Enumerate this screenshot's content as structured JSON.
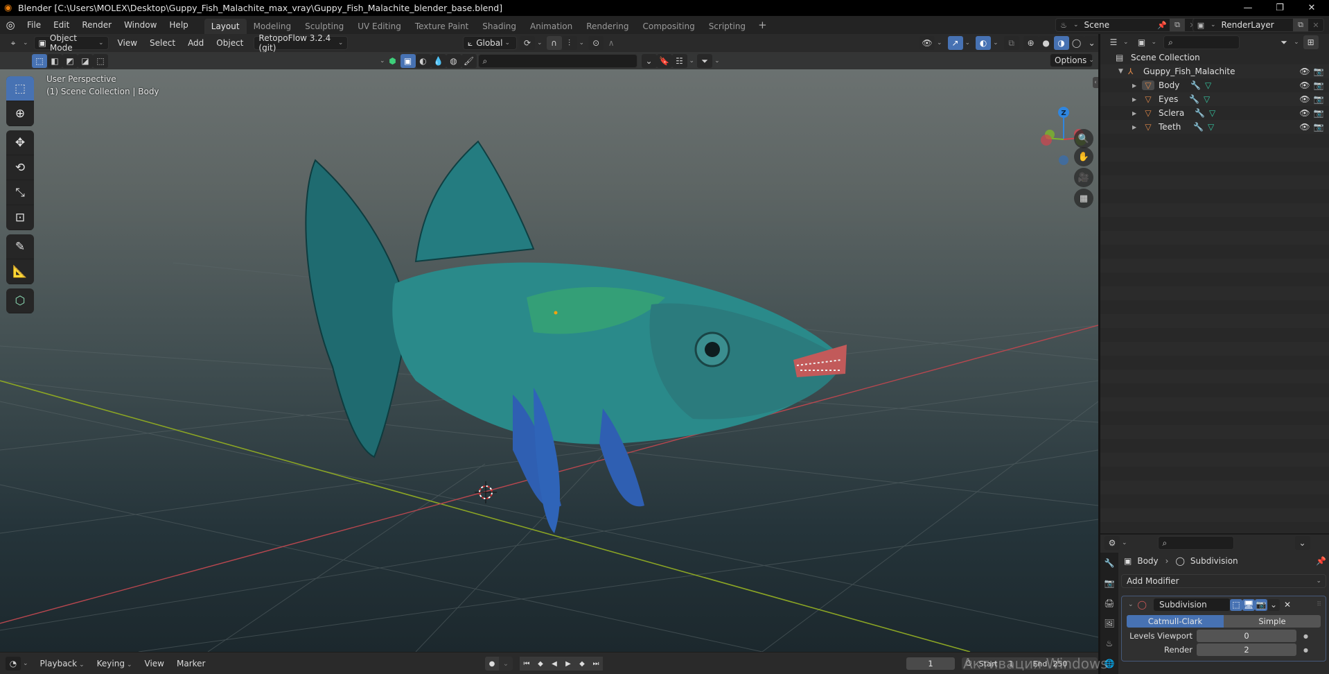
{
  "window": {
    "title": "Blender [C:\\Users\\MOLEX\\Desktop\\Guppy_Fish_Malachite_max_vray\\Guppy_Fish_Malachite_blender_base.blend]",
    "controls": [
      "minimize",
      "restore",
      "close"
    ]
  },
  "menubar": {
    "items": [
      "File",
      "Edit",
      "Render",
      "Window",
      "Help"
    ],
    "workspaces": [
      "Layout",
      "Modeling",
      "Sculpting",
      "UV Editing",
      "Texture Paint",
      "Shading",
      "Animation",
      "Rendering",
      "Compositing",
      "Scripting"
    ],
    "active_workspace": "Layout",
    "add_workspace": "+",
    "scene": "Scene",
    "view_layer": "RenderLayer"
  },
  "viewport": {
    "mode": "Object Mode",
    "menus": [
      "View",
      "Select",
      "Add",
      "Object"
    ],
    "addon_menu": "RetopoFlow 3.2.4 (git)",
    "transform_orientation": "Global",
    "options_label": "Options",
    "overlay_title": "User Perspective",
    "overlay_subtitle": "(1) Scene Collection | Body",
    "gizmo_axes": {
      "z": "Z"
    },
    "accent_color": "#4772b3"
  },
  "toolbar": {
    "tools": [
      "select-box",
      "cursor",
      "move",
      "rotate",
      "scale",
      "transform",
      "annotate",
      "measure",
      "add-cube"
    ],
    "active": "select-box"
  },
  "outliner": {
    "root": "Scene Collection",
    "collection": "Guppy_Fish_Malachite",
    "objects": [
      {
        "name": "Body",
        "active": true
      },
      {
        "name": "Eyes",
        "active": false
      },
      {
        "name": "Sclera",
        "active": false
      },
      {
        "name": "Teeth",
        "active": false
      }
    ]
  },
  "properties": {
    "breadcrumb_object": "Body",
    "breadcrumb_modifier": "Subdivision",
    "add_modifier_label": "Add Modifier",
    "modifier": {
      "name": "Subdivision",
      "types": [
        "Catmull-Clark",
        "Simple"
      ],
      "active_type": "Catmull-Clark",
      "levels_viewport_label": "Levels Viewport",
      "levels_viewport": "0",
      "render_label": "Render",
      "render": "2"
    }
  },
  "timeline": {
    "menus": [
      "Playback",
      "Keying",
      "View",
      "Marker"
    ],
    "current_frame": "1",
    "start_label": "Start",
    "start": "1",
    "end_label": "End",
    "end": "250"
  },
  "watermark": "Активация Windows"
}
